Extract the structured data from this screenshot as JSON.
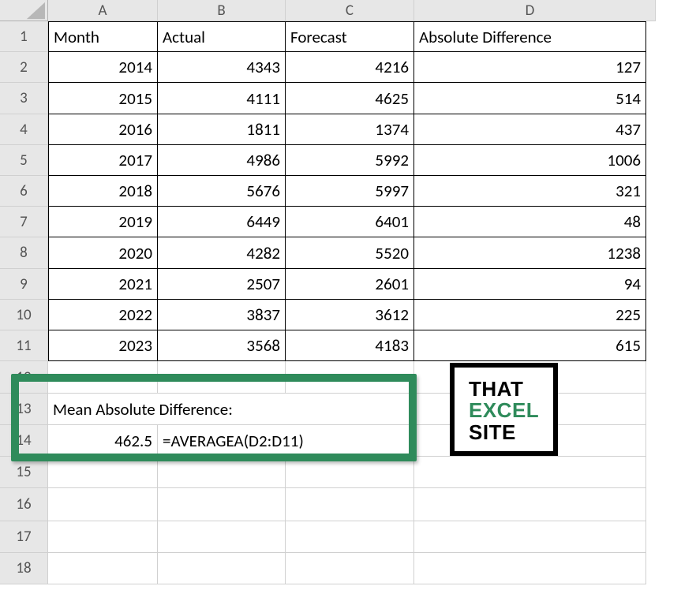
{
  "columns": {
    "corner": "",
    "labels": [
      "A",
      "B",
      "C",
      "D"
    ],
    "widths": [
      61,
      139,
      162,
      163,
      294
    ]
  },
  "rows": {
    "labels": [
      "1",
      "2",
      "3",
      "4",
      "5",
      "6",
      "7",
      "8",
      "9",
      "10",
      "11",
      "12",
      "13",
      "14",
      "15",
      "16",
      "17",
      "18"
    ],
    "heights": [
      27,
      39,
      39,
      40,
      39,
      39,
      39,
      39,
      40,
      39,
      39,
      39,
      41,
      40,
      40,
      40,
      42,
      40,
      40
    ]
  },
  "table": {
    "headerRow": 1,
    "headers": {
      "A": "Month",
      "B": "Actual",
      "C": "Forecast",
      "D": "Absolute Difference"
    },
    "data": [
      {
        "row": 2,
        "A": "2014",
        "B": "4343",
        "C": "4216",
        "D": "127"
      },
      {
        "row": 3,
        "A": "2015",
        "B": "4111",
        "C": "4625",
        "D": "514"
      },
      {
        "row": 4,
        "A": "2016",
        "B": "1811",
        "C": "1374",
        "D": "437"
      },
      {
        "row": 5,
        "A": "2017",
        "B": "4986",
        "C": "5992",
        "D": "1006"
      },
      {
        "row": 6,
        "A": "2018",
        "B": "5676",
        "C": "5997",
        "D": "321"
      },
      {
        "row": 7,
        "A": "2019",
        "B": "6449",
        "C": "6401",
        "D": "48"
      },
      {
        "row": 8,
        "A": "2020",
        "B": "4282",
        "C": "5520",
        "D": "1238"
      },
      {
        "row": 9,
        "A": "2021",
        "B": "2507",
        "C": "2601",
        "D": "94"
      },
      {
        "row": 10,
        "A": "2022",
        "B": "3837",
        "C": "3612",
        "D": "225"
      },
      {
        "row": 11,
        "A": "2023",
        "B": "3568",
        "C": "4183",
        "D": "615"
      }
    ]
  },
  "summary": {
    "label_cell": "Mean Absolute Difference:",
    "value": "462.5",
    "formula": "=AVERAGEA(D2:D11)"
  },
  "logo": {
    "line1": "THAT",
    "line2": "EXCEL",
    "line3": "SITE"
  },
  "highlight_color": "#2f8b5b"
}
